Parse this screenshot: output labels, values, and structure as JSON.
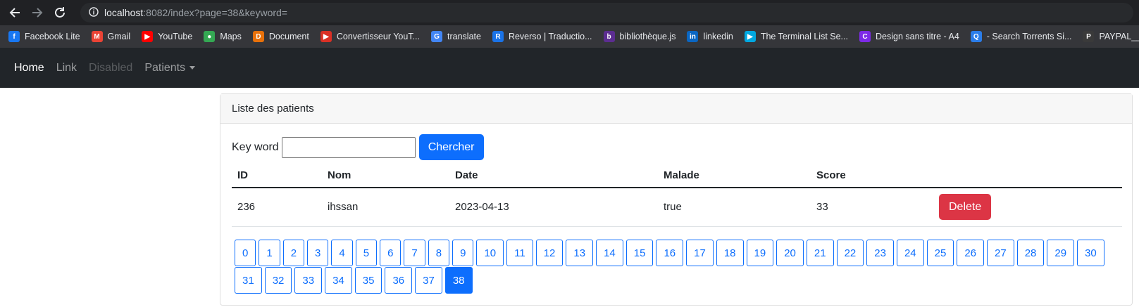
{
  "browser": {
    "url_host": "localhost",
    "url_rest": ":8082/index?page=38&keyword=",
    "bookmarks": [
      {
        "label": "Facebook Lite",
        "icon": "facebook-icon",
        "color": "#1877f2",
        "glyph": "f"
      },
      {
        "label": "Gmail",
        "icon": "gmail-icon",
        "color": "#ea4335",
        "glyph": "M"
      },
      {
        "label": "YouTube",
        "icon": "youtube-icon",
        "color": "#ff0000",
        "glyph": "▶"
      },
      {
        "label": "Maps",
        "icon": "maps-icon",
        "color": "#34a853",
        "glyph": "●"
      },
      {
        "label": "Document",
        "icon": "document-icon",
        "color": "#e8710a",
        "glyph": "D"
      },
      {
        "label": "Convertisseur YouT...",
        "icon": "converter-icon",
        "color": "#d93025",
        "glyph": "▶"
      },
      {
        "label": "translate",
        "icon": "translate-icon",
        "color": "#4285f4",
        "glyph": "G"
      },
      {
        "label": "Reverso | Traductio...",
        "icon": "reverso-icon",
        "color": "#1a73e8",
        "glyph": "R"
      },
      {
        "label": "bibliothèque.js",
        "icon": "library-icon",
        "color": "#5c2d91",
        "glyph": "b"
      },
      {
        "label": "linkedin",
        "icon": "linkedin-icon",
        "color": "#0a66c2",
        "glyph": "in"
      },
      {
        "label": "The Terminal List Se...",
        "icon": "prime-icon",
        "color": "#00a8e1",
        "glyph": "▶"
      },
      {
        "label": "Design sans titre - A4",
        "icon": "canva-icon",
        "color": "#7d2ae8",
        "glyph": "C"
      },
      {
        "label": "- Search Torrents Si...",
        "icon": "torrent-icon",
        "color": "#2b7de9",
        "glyph": "Q"
      },
      {
        "label": "PAYPAL__sandbox.b",
        "icon": "paypal-icon",
        "color": "#3a3a3a",
        "glyph": "P"
      }
    ]
  },
  "navbar": {
    "home": "Home",
    "link": "Link",
    "disabled": "Disabled",
    "patients": "Patients"
  },
  "card": {
    "title": "Liste des patients",
    "search_label": "Key word",
    "search_value": "",
    "search_button": "Chercher"
  },
  "table": {
    "headers": [
      "ID",
      "Nom",
      "Date",
      "Malade",
      "Score",
      ""
    ],
    "rows": [
      {
        "id": "236",
        "nom": "ihssan",
        "date": "2023-04-13",
        "malade": "true",
        "score": "33",
        "action": "Delete"
      }
    ]
  },
  "pagination": {
    "pages": [
      "0",
      "1",
      "2",
      "3",
      "4",
      "5",
      "6",
      "7",
      "8",
      "9",
      "10",
      "11",
      "12",
      "13",
      "14",
      "15",
      "16",
      "17",
      "18",
      "19",
      "20",
      "21",
      "22",
      "23",
      "24",
      "25",
      "26",
      "27",
      "28",
      "29",
      "30",
      "31",
      "32",
      "33",
      "34",
      "35",
      "36",
      "37",
      "38"
    ],
    "current": "38"
  }
}
